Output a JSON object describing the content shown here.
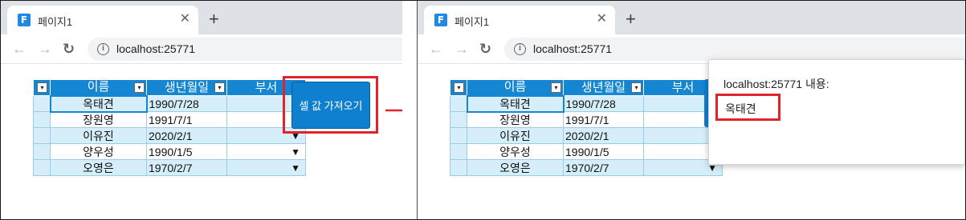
{
  "browser": {
    "tab_title": "페이지1",
    "favicon_letter": "F",
    "close_glyph": "✕",
    "new_tab_glyph": "+",
    "url": "localhost:25771",
    "back_glyph": "←",
    "forward_glyph": "→",
    "reload_glyph": "↻",
    "info_glyph": "i"
  },
  "grid": {
    "columns": [
      "이름",
      "생년월일",
      "부서"
    ],
    "header_button_glyph": "▾",
    "dropdown_glyph": "▼",
    "rows": [
      {
        "name": "옥태견",
        "birth": "1990/7/28"
      },
      {
        "name": "장원영",
        "birth": "1991/7/1"
      },
      {
        "name": "이유진",
        "birth": "2020/2/1"
      },
      {
        "name": "양우성",
        "birth": "1990/1/5"
      },
      {
        "name": "오영은",
        "birth": "1970/2/7"
      }
    ]
  },
  "button": {
    "label": "셀 값 가져오기"
  },
  "dialog": {
    "title": "localhost:25771 내용:",
    "message": "옥태견"
  },
  "colors": {
    "header_blue": "#1586d2",
    "row_alt": "#d6eef9",
    "highlight_red": "#e0242c"
  }
}
